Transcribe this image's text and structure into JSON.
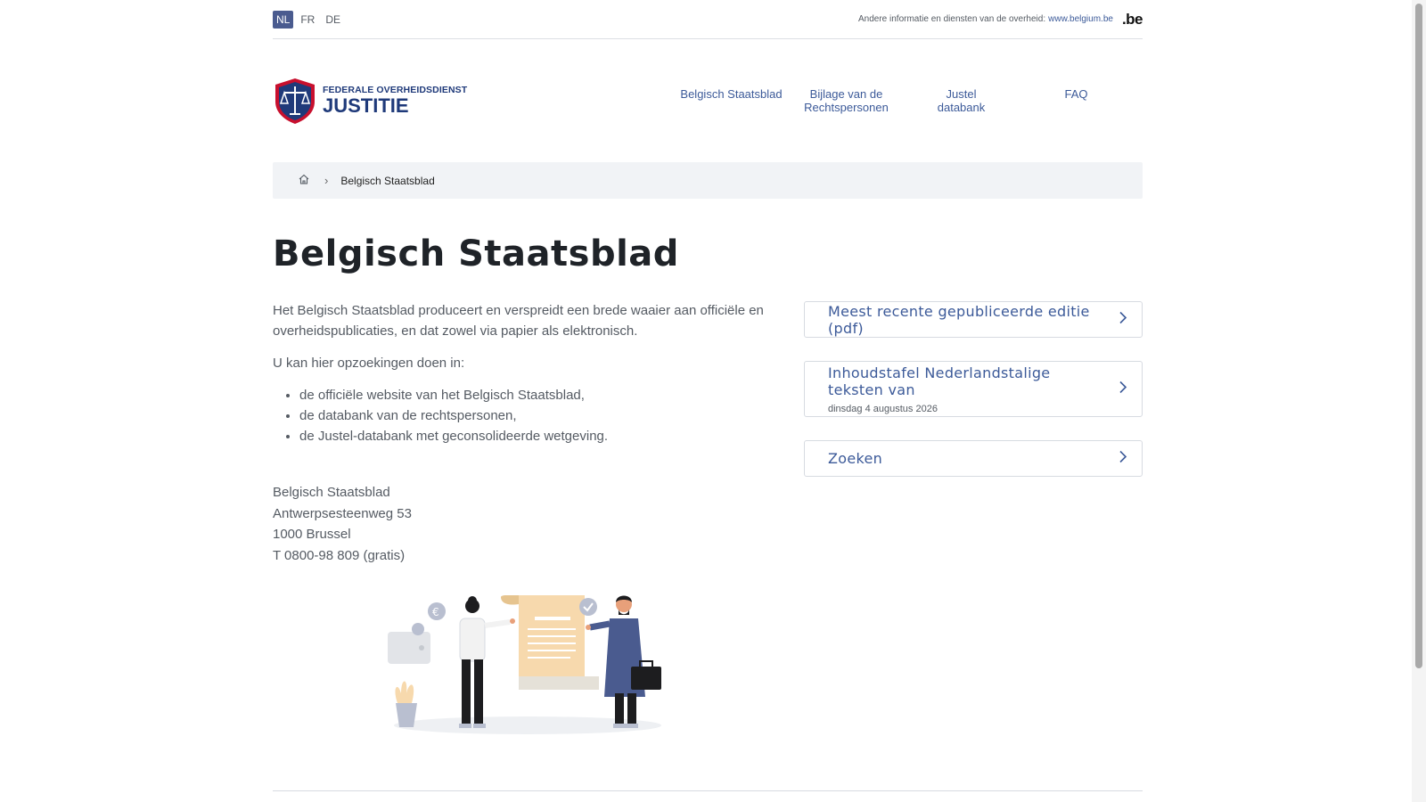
{
  "topbar": {
    "languages": [
      {
        "code": "NL",
        "active": true
      },
      {
        "code": "FR",
        "active": false
      },
      {
        "code": "DE",
        "active": false
      }
    ],
    "info_text": "Andere informatie en diensten van de overheid:",
    "info_link": "www.belgium.be",
    "be_logo": ".be"
  },
  "header": {
    "logo_sub": "FEDERALE OVERHEIDSDIENST",
    "logo_main": "JUSTITIE",
    "nav": [
      {
        "line1": "Belgisch Staatsblad",
        "line2": ""
      },
      {
        "line1": "Bijlage van de",
        "line2": "Rechtspersonen"
      },
      {
        "line1": "Justel",
        "line2": "databank"
      },
      {
        "line1": "FAQ",
        "line2": ""
      }
    ]
  },
  "breadcrumb": {
    "home_icon": "home-icon",
    "current": "Belgisch Staatsblad"
  },
  "page": {
    "title": "Belgisch Staatsblad",
    "intro": "Het Belgisch Staatsblad produceert en verspreidt een brede waaier aan officiële en overheidspublicaties, en dat zowel via papier als elektronisch.",
    "search_intro": "U kan hier opzoekingen doen in:",
    "list": [
      "de officiële website van het Belgisch Staatsblad,",
      "de databank van de rechtspersonen,",
      "de Justel-databank met geconsolideerde wetgeving."
    ],
    "address": [
      "Belgisch Staatsblad",
      "Antwerpsesteenweg 53",
      "1000 Brussel",
      "T 0800-98 809 (gratis)"
    ]
  },
  "cards": [
    {
      "title": "Meest recente gepubliceerde editie (pdf)",
      "sub": ""
    },
    {
      "title": "Inhoudstafel Nederlandstalige teksten van",
      "sub": "dinsdag 4 augustus 2026"
    },
    {
      "title": "Zoeken",
      "sub": ""
    }
  ],
  "colors": {
    "accent": "#3c5a99",
    "active_lang": "#4a5b8f",
    "logo_blue": "#1f3a7a",
    "logo_red": "#c8102e",
    "breadcrumb_bg": "#f1f3f6"
  }
}
